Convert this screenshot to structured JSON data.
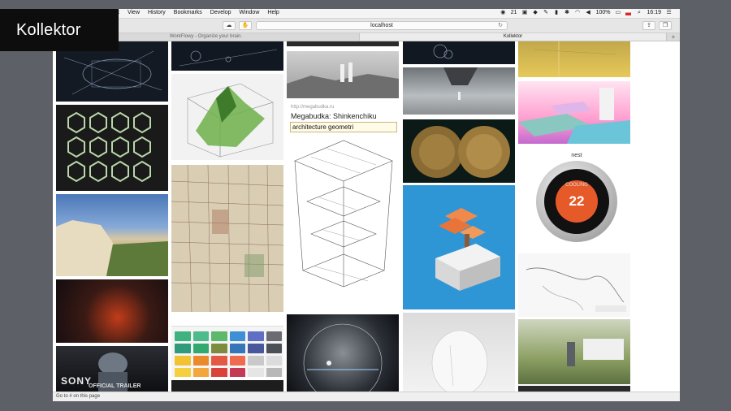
{
  "slide": {
    "title": "Kollektor"
  },
  "menubar": {
    "menus": [
      "t",
      "View",
      "History",
      "Bookmarks",
      "Develop",
      "Window",
      "Help"
    ],
    "status": {
      "notifications": "21",
      "battery": "100%",
      "time": "16:19"
    }
  },
  "browser": {
    "address": "localhost",
    "tabs": [
      {
        "label": "WorkFlowy - Organize your brain.",
        "active": false
      },
      {
        "label": "Kollektor",
        "active": true
      }
    ],
    "tab_add": "+",
    "status_text": "Go to # on this page"
  },
  "kollektor": {
    "note": {
      "url": "http://megabudka.ru",
      "title": "Megabudka: Shinkenchiku",
      "tag_input": "architecture geometri"
    },
    "nest": {
      "brand": "nest",
      "temperature": "22",
      "label": "COOLING"
    },
    "video": {
      "brand": "SONY",
      "caption": "OFFICIAL TRAILER"
    },
    "colors": {
      "palette": [
        "#3fb37f",
        "#4dbb8c",
        "#5cb86a",
        "#3f8fd6",
        "#5f6fc4",
        "#6b6b74",
        "#2f9b7c",
        "#33a870",
        "#7d8b3f",
        "#3675b8",
        "#48579b",
        "#4b4f58",
        "#f1c232",
        "#ea8a2b",
        "#e25a43",
        "#ef6a4f",
        "#c9c9c9",
        "#dcdcdc",
        "#f4d03f",
        "#f2a63c",
        "#d9433c",
        "#c43a55",
        "#e5e5e5",
        "#b8b8b8"
      ]
    }
  }
}
